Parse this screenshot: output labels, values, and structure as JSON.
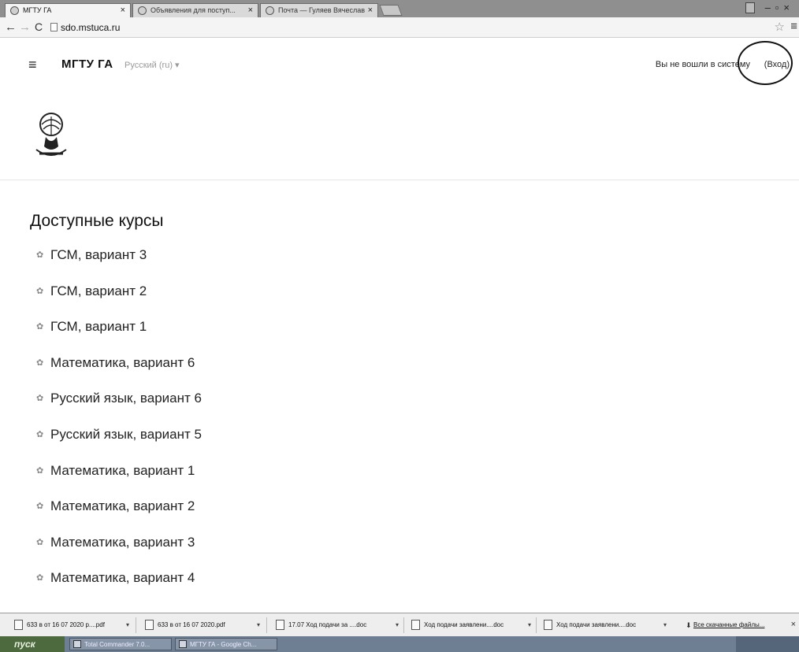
{
  "browser": {
    "tabs": [
      {
        "title": "МГТУ ГА",
        "active": true
      },
      {
        "title": "Объявления для поступ...",
        "active": false
      },
      {
        "title": "Почта — Гуляев Вячеслав",
        "active": false
      }
    ],
    "url": "sdo.mstuca.ru"
  },
  "site": {
    "name": "МГТУ ГА",
    "language": "Русский (ru) ▾",
    "login_text": "Вы не вошли в систему",
    "login_link": "(Вход)"
  },
  "courses": {
    "title": "Доступные курсы",
    "items": [
      "ГСМ, вариант 3",
      "ГСМ, вариант 2",
      "ГСМ, вариант 1",
      "Математика, вариант 6",
      "Русский язык, вариант 6",
      "Русский язык, вариант 5",
      "Математика, вариант 1",
      "Математика, вариант 2",
      "Математика, вариант 3",
      "Математика, вариант 4"
    ]
  },
  "downloads": {
    "items": [
      "633 в от 16 07 2020 р....pdf",
      "633 в от 16 07 2020.pdf",
      "17.07 Ход подачи за ....doc",
      "Ход подачи заявлени....doc",
      "Ход подачи заявлени....doc"
    ],
    "show_all": "Все скачанные файлы..."
  },
  "taskbar": {
    "start": "пуск",
    "tasks": [
      "Total Commander 7.0...",
      "МГТУ ГА - Google Ch..."
    ]
  }
}
